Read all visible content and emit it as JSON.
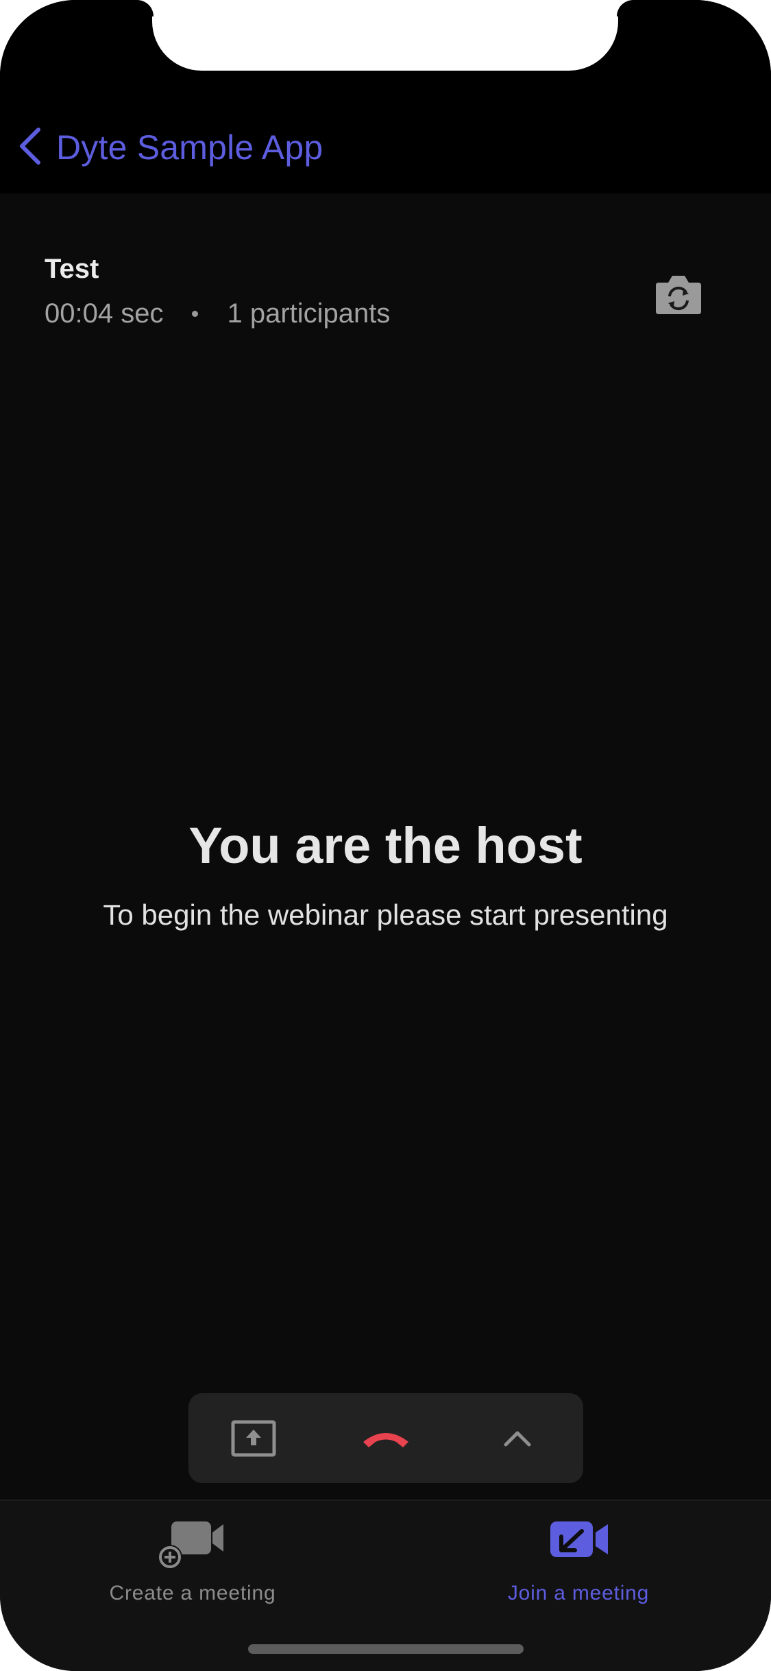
{
  "nav": {
    "back_label": "Dyte Sample App"
  },
  "meeting": {
    "title": "Test",
    "duration": "00:04 sec",
    "participants": "1 participants"
  },
  "center": {
    "heading": "You are the host",
    "subtext": "To begin the webinar please start presenting"
  },
  "controls": {
    "share_icon": "screen-share-icon",
    "leave_icon": "end-call-icon",
    "more_icon": "chevron-up-icon"
  },
  "tabs": [
    {
      "label": "Create a meeting",
      "icon": "video-add-icon",
      "active": false
    },
    {
      "label": "Join a meeting",
      "icon": "video-join-icon",
      "active": true
    }
  ],
  "colors": {
    "accent": "#5d5de0",
    "end_call": "#e8434e",
    "background": "#0b0b0b"
  }
}
